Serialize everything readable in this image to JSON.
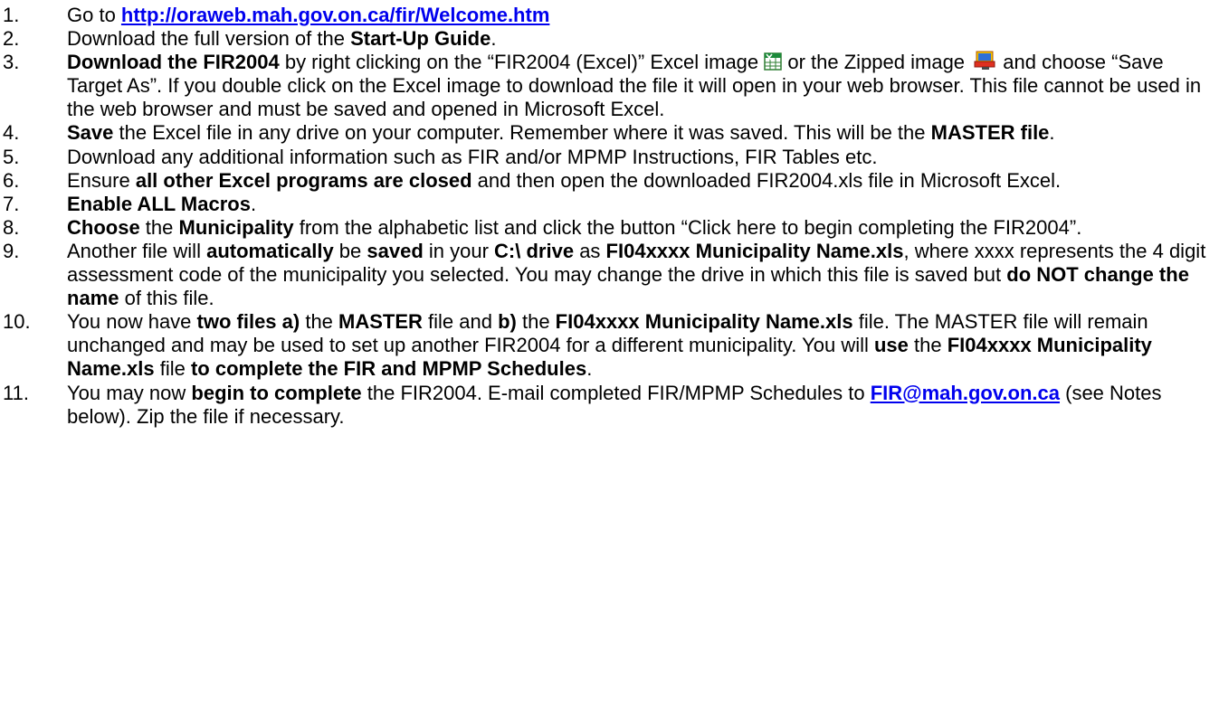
{
  "steps": [
    {
      "num": "1.",
      "segments": [
        {
          "t": "Go to ",
          "s": "n"
        },
        {
          "t": "http://oraweb.mah.gov.on.ca/fir/Welcome.htm",
          "s": "link"
        }
      ]
    },
    {
      "num": "2.",
      "segments": [
        {
          "t": "Download the full version of the ",
          "s": "n"
        },
        {
          "t": "Start-Up Guide",
          "s": "b"
        },
        {
          "t": ".",
          "s": "n"
        }
      ]
    },
    {
      "num": "3.",
      "segments": [
        {
          "t": "Download the FIR2004",
          "s": "b"
        },
        {
          "t": " by right clicking on the “FIR2004 (Excel)” Excel image ",
          "s": "n"
        },
        {
          "icon": "excel-file-icon"
        },
        {
          "t": " or the Zipped image ",
          "s": "n"
        },
        {
          "icon": "zip-file-icon"
        },
        {
          "t": "  and choose “Save Target As”.  If you double click on the Excel image to download the file it will open in your web browser.  This file cannot be used in the web browser and must be saved and opened in Microsoft Excel.",
          "s": "n"
        }
      ]
    },
    {
      "num": "4.",
      "segments": [
        {
          "t": "Save",
          "s": "b"
        },
        {
          "t": " the Excel file in any drive on your computer.  Remember where it was saved.  This will be the ",
          "s": "n"
        },
        {
          "t": "MASTER file",
          "s": "b"
        },
        {
          "t": ".",
          "s": "n"
        }
      ]
    },
    {
      "num": "5.",
      "segments": [
        {
          "t": "Download any additional information such as FIR and/or MPMP Instructions, FIR Tables etc.",
          "s": "n"
        }
      ]
    },
    {
      "num": "6.",
      "segments": [
        {
          "t": "Ensure ",
          "s": "n"
        },
        {
          "t": "all other Excel programs are closed",
          "s": "b"
        },
        {
          "t": " and then open the downloaded FIR2004.xls file in Microsoft Excel.",
          "s": "n"
        }
      ]
    },
    {
      "num": "7.",
      "segments": [
        {
          "t": "Enable ALL Macros",
          "s": "b"
        },
        {
          "t": ".",
          "s": "n"
        }
      ]
    },
    {
      "num": "8.",
      "segments": [
        {
          "t": "Choose",
          "s": "b"
        },
        {
          "t": " the ",
          "s": "n"
        },
        {
          "t": "Municipality",
          "s": "b"
        },
        {
          "t": " from the alphabetic list and click the button “Click here to begin completing the FIR2004”.",
          "s": "n"
        }
      ]
    },
    {
      "num": "9.",
      "segments": [
        {
          "t": "Another file will ",
          "s": "n"
        },
        {
          "t": "automatically",
          "s": "b"
        },
        {
          "t": " be ",
          "s": "n"
        },
        {
          "t": "saved",
          "s": "b"
        },
        {
          "t": " in your ",
          "s": "n"
        },
        {
          "t": "C:\\ drive",
          "s": "b"
        },
        {
          "t": " as ",
          "s": "n"
        },
        {
          "t": "FI04xxxx Municipality Name.xls",
          "s": "b"
        },
        {
          "t": ", where xxxx represents the 4 digit assessment code of the municipality you selected.  You may change the drive in which this file is saved but ",
          "s": "n"
        },
        {
          "t": "do NOT change the name",
          "s": "b"
        },
        {
          "t": " of this file.",
          "s": "n"
        }
      ]
    },
    {
      "num": "10.",
      "segments": [
        {
          "t": "You now have ",
          "s": "n"
        },
        {
          "t": "two files a)",
          "s": "b"
        },
        {
          "t": " the ",
          "s": "n"
        },
        {
          "t": "MASTER",
          "s": "b"
        },
        {
          "t": " file and ",
          "s": "n"
        },
        {
          "t": "b)",
          "s": "b"
        },
        {
          "t": " the ",
          "s": "n"
        },
        {
          "t": "FI04xxxx Municipality Name.xls",
          "s": "b"
        },
        {
          "t": " file.  The MASTER file will remain unchanged and may be used to set up another FIR2004 for a different municipality.  You will ",
          "s": "n"
        },
        {
          "t": "use",
          "s": "b"
        },
        {
          "t": " the ",
          "s": "n"
        },
        {
          "t": "FI04xxxx Municipality Name.xls",
          "s": "b"
        },
        {
          "t": " file ",
          "s": "n"
        },
        {
          "t": "to complete the FIR and MPMP Schedules",
          "s": "b"
        },
        {
          "t": ".",
          "s": "n"
        }
      ]
    },
    {
      "num": "11.",
      "segments": [
        {
          "t": "You may now ",
          "s": "n"
        },
        {
          "t": "begin to complete",
          "s": "b"
        },
        {
          "t": " the FIR2004.  E-mail completed FIR/MPMP Schedules to ",
          "s": "n"
        },
        {
          "t": "FIR@mah.gov.on.ca",
          "s": "link"
        },
        {
          "t": "  (see Notes below).  Zip the file if necessary.",
          "s": "n"
        }
      ]
    }
  ]
}
